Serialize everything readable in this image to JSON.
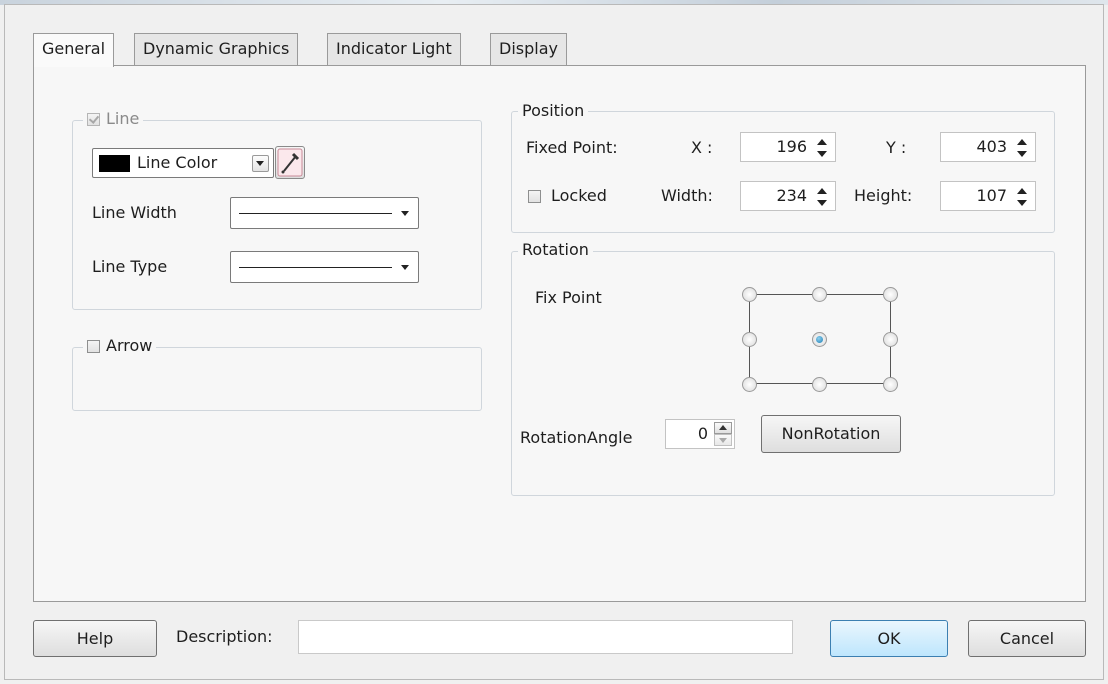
{
  "tabs": [
    "General",
    "Dynamic Graphics",
    "Indicator Light",
    "Display"
  ],
  "active_tab": "General",
  "line_group": {
    "label": "Line",
    "checked": true,
    "color_label": "Line Color",
    "color_swatch": "#000000",
    "width_label": "Line Width",
    "type_label": "Line Type"
  },
  "arrow_group": {
    "label": "Arrow",
    "checked": false
  },
  "position": {
    "title": "Position",
    "fixed_point_label": "Fixed Point:",
    "x_label": "X :",
    "x_value": "196",
    "y_label": "Y :",
    "y_value": "403",
    "locked_label": "Locked",
    "locked": false,
    "width_label": "Width:",
    "width_value": "234",
    "height_label": "Height:",
    "height_value": "107"
  },
  "rotation": {
    "title": "Rotation",
    "fix_point_label": "Fix Point",
    "selected_point": "center",
    "angle_label": "RotationAngle",
    "angle_value": "0",
    "nonrotation_button": "NonRotation"
  },
  "footer": {
    "help_button": "Help",
    "description_label": "Description:",
    "description_value": "",
    "ok_button": "OK",
    "cancel_button": "Cancel"
  },
  "accent_color": "#3c7fb1",
  "icons": [
    "color-picker-icon",
    "dropdown-arrow-icon",
    "spin-arrows-icon"
  ]
}
